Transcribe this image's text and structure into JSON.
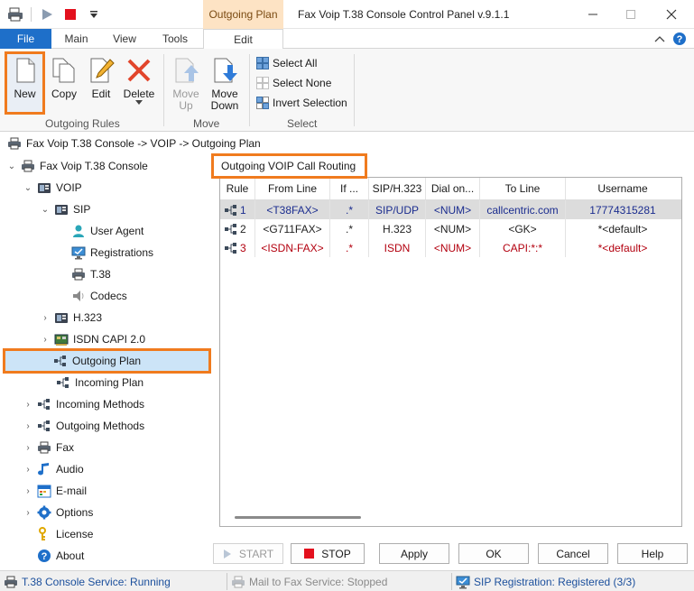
{
  "window": {
    "title": "Fax Voip T.38 Console Control Panel v.9.1.1",
    "context_tab_header": "Outgoing Plan",
    "controls": [
      "minimize",
      "maximize",
      "close"
    ]
  },
  "ribbon": {
    "tabs": [
      {
        "label": "File"
      },
      {
        "label": "Main"
      },
      {
        "label": "View"
      },
      {
        "label": "Tools"
      },
      {
        "label": "Edit"
      }
    ],
    "groups": {
      "outgoing_rules": {
        "label": "Outgoing Rules",
        "buttons": [
          {
            "label": "New"
          },
          {
            "label": "Copy"
          },
          {
            "label": "Edit"
          },
          {
            "label": "Delete"
          }
        ]
      },
      "move": {
        "label": "Move",
        "buttons": [
          {
            "label": "Move Up",
            "line1": "Move",
            "line2": "Up"
          },
          {
            "label": "Move Down",
            "line1": "Move",
            "line2": "Down"
          }
        ]
      },
      "select": {
        "label": "Select",
        "items": [
          {
            "label": "Select All"
          },
          {
            "label": "Select None"
          },
          {
            "label": "Invert Selection"
          }
        ]
      }
    }
  },
  "breadcrumb": {
    "text": "Fax Voip T.38 Console -> VOIP -> Outgoing Plan"
  },
  "tree": {
    "items": [
      {
        "label": "Fax Voip T.38 Console"
      },
      {
        "label": "VOIP"
      },
      {
        "label": "SIP"
      },
      {
        "label": "User Agent"
      },
      {
        "label": "Registrations"
      },
      {
        "label": "T.38"
      },
      {
        "label": "Codecs"
      },
      {
        "label": "H.323"
      },
      {
        "label": "ISDN CAPI 2.0"
      },
      {
        "label": "Outgoing Plan"
      },
      {
        "label": "Incoming Plan"
      },
      {
        "label": "Incoming Methods"
      },
      {
        "label": "Outgoing Methods"
      },
      {
        "label": "Fax"
      },
      {
        "label": "Audio"
      },
      {
        "label": "E-mail"
      },
      {
        "label": "Options"
      },
      {
        "label": "License"
      },
      {
        "label": "About"
      }
    ]
  },
  "panel": {
    "title": "Outgoing VOIP Call Routing",
    "columns": [
      "Rule",
      "From Line",
      "If ...",
      "SIP/H.323",
      "Dial on...",
      "To Line",
      "Username"
    ],
    "rows": [
      {
        "rule": "1",
        "from": "<T38FAX>",
        "if": ".*",
        "proto": "SIP/UDP",
        "dial": "<NUM>",
        "to": "callcentric.com",
        "user": "17774315281"
      },
      {
        "rule": "2",
        "from": "<G711FAX>",
        "if": ".*",
        "proto": "H.323",
        "dial": "<NUM>",
        "to": "<GK>",
        "user": "*<default>"
      },
      {
        "rule": "3",
        "from": "<ISDN-FAX>",
        "if": ".*",
        "proto": "ISDN",
        "dial": "<NUM>",
        "to": "CAPI:*:*",
        "user": "*<default>"
      }
    ]
  },
  "buttons": {
    "start": "START",
    "stop": "STOP",
    "apply": "Apply",
    "ok": "OK",
    "cancel": "Cancel",
    "help": "Help"
  },
  "status": {
    "t38": "T.38 Console Service: Running",
    "mail": "Mail to Fax Service: Stopped",
    "sip": "SIP Registration: Registered (3/3)"
  },
  "colors": {
    "accent_orange": "#f07b1e",
    "file_tab": "#1e6fc9",
    "context_tab": "#fde3c4",
    "selection": "#cce4f7",
    "row_blue": "#1b2d8f",
    "row_red": "#b3000f"
  }
}
